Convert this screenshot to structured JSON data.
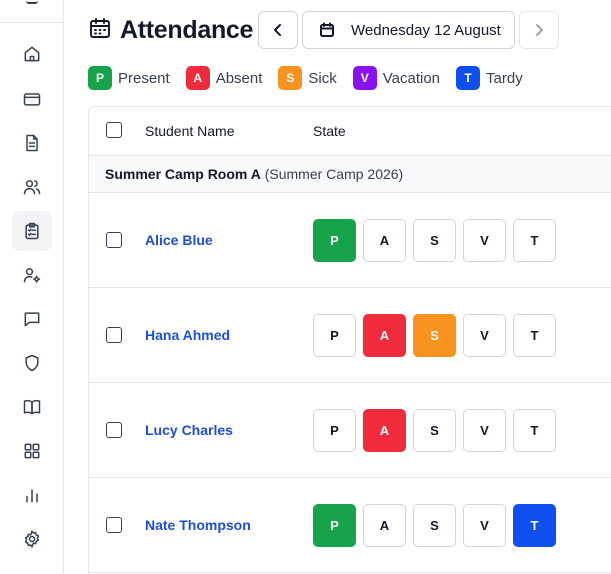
{
  "sidebar": {
    "items": [
      {
        "name": "home-icon",
        "active": false
      },
      {
        "name": "credit-card-icon",
        "active": false
      },
      {
        "name": "document-icon",
        "active": false
      },
      {
        "name": "users-icon",
        "active": false
      },
      {
        "name": "clipboard-check-icon",
        "active": true
      },
      {
        "name": "user-settings-icon",
        "active": false
      },
      {
        "name": "chat-icon",
        "active": false
      },
      {
        "name": "shield-icon",
        "active": false
      },
      {
        "name": "book-icon",
        "active": false
      },
      {
        "name": "grid-icon",
        "active": false
      },
      {
        "name": "bar-chart-icon",
        "active": false
      },
      {
        "name": "settings-icon",
        "active": false
      }
    ]
  },
  "header": {
    "title": "Attendance",
    "date": "Wednesday 12 August"
  },
  "legend": [
    {
      "code": "P",
      "label": "Present",
      "color": "#16a34a"
    },
    {
      "code": "A",
      "label": "Absent",
      "color": "#ef2b3c"
    },
    {
      "code": "S",
      "label": "Sick",
      "color": "#f7931e"
    },
    {
      "code": "V",
      "label": "Vacation",
      "color": "#8b12f0"
    },
    {
      "code": "T",
      "label": "Tardy",
      "color": "#0f4ff0"
    }
  ],
  "table": {
    "columns": {
      "name": "Student Name",
      "state": "State"
    },
    "group": {
      "name": "Summer Camp Room A",
      "sub": "(Summer Camp 2026)"
    },
    "rows": [
      {
        "name": "Alice Blue",
        "active": [
          "P"
        ]
      },
      {
        "name": "Hana Ahmed",
        "active": [
          "A",
          "S"
        ]
      },
      {
        "name": "Lucy Charles",
        "active": [
          "A"
        ]
      },
      {
        "name": "Nate Thompson",
        "active": [
          "P",
          "T"
        ]
      }
    ]
  }
}
